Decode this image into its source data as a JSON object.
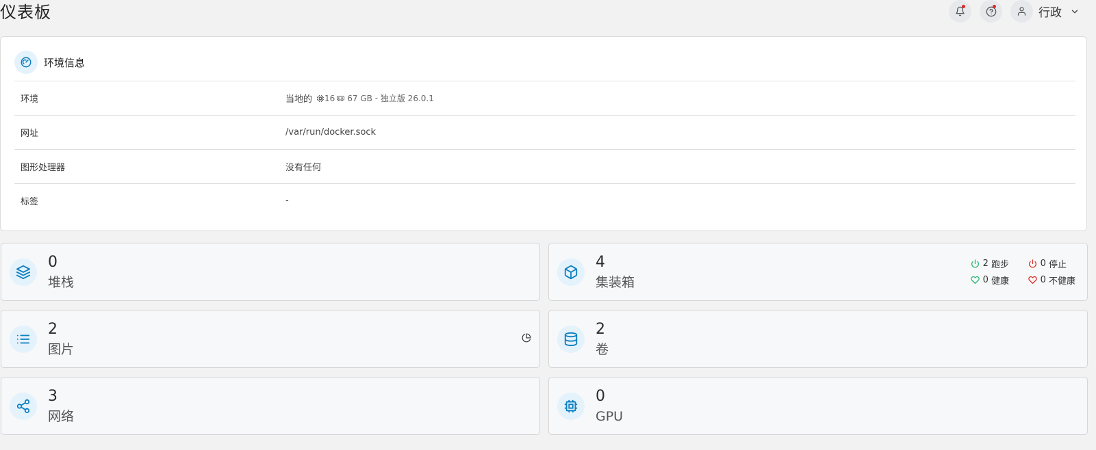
{
  "page": {
    "title": "仪表板"
  },
  "topbar": {
    "user_name": "行政"
  },
  "environment_card": {
    "title": "环境信息",
    "rows": [
      {
        "key": "环境",
        "value": "当地的",
        "cpu_count": "16",
        "memory": "67 GB - 独立版 26.0.1"
      },
      {
        "key": "网址",
        "value": "/var/run/docker.sock"
      },
      {
        "key": "图形处理器",
        "value": "没有任何"
      },
      {
        "key": "标签",
        "value": "-"
      }
    ]
  },
  "stats": {
    "stacks": {
      "count": "0",
      "label": "堆栈",
      "icon": "layers-icon"
    },
    "containers": {
      "count": "4",
      "label": "集装箱",
      "icon": "cube-icon",
      "status": {
        "running": {
          "count": "2",
          "label": "跑步"
        },
        "stopped": {
          "count": "0",
          "label": "停止"
        },
        "healthy": {
          "count": "0",
          "label": "健康"
        },
        "unhealthy": {
          "count": "0",
          "label": "不健康"
        }
      }
    },
    "images": {
      "count": "2",
      "label": "图片",
      "icon": "list-icon"
    },
    "volumes": {
      "count": "2",
      "label": "卷",
      "icon": "database-icon"
    },
    "networks": {
      "count": "3",
      "label": "网络",
      "icon": "share-icon"
    },
    "gpus": {
      "count": "0",
      "label": "GPU",
      "icon": "cpu-chip-icon"
    }
  },
  "colors": {
    "accent": "#0d7fc0",
    "icon_bg": "#e4f2fb",
    "running": "#2bb673",
    "stopped": "#d9342b",
    "notification_dot": "#e22727"
  }
}
